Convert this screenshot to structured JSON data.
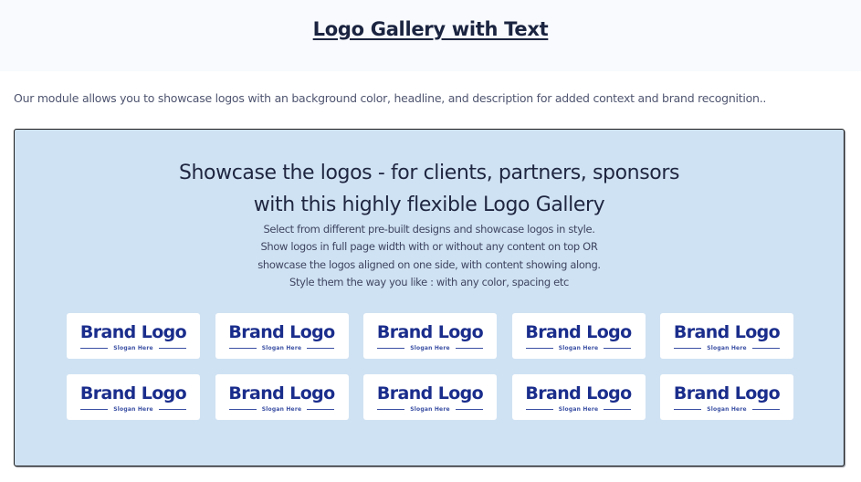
{
  "header": {
    "title": "Logo Gallery with Text"
  },
  "intro": {
    "text": "Our module allows you to showcase logos with an background color, headline, and description for added context and brand recognition.."
  },
  "showcase": {
    "headline_line1": "Showcase the logos - for clients, partners, sponsors",
    "headline_line2": "with this highly flexible Logo Gallery",
    "description_lines": [
      "Select from different pre-built designs and showcase logos in style.",
      "Show logos in full page width with or without any content on top OR",
      "showcase the logos aligned  on one side, with content showing along.",
      "Style them the way you like : with any color, spacing etc"
    ],
    "logos": [
      {
        "brand": "Brand Logo",
        "slogan": "Slogan Here"
      },
      {
        "brand": "Brand Logo",
        "slogan": "Slogan Here"
      },
      {
        "brand": "Brand Logo",
        "slogan": "Slogan Here"
      },
      {
        "brand": "Brand Logo",
        "slogan": "Slogan Here"
      },
      {
        "brand": "Brand Logo",
        "slogan": "Slogan Here"
      },
      {
        "brand": "Brand Logo",
        "slogan": "Slogan Here"
      },
      {
        "brand": "Brand Logo",
        "slogan": "Slogan Here"
      },
      {
        "brand": "Brand Logo",
        "slogan": "Slogan Here"
      },
      {
        "brand": "Brand Logo",
        "slogan": "Slogan Here"
      },
      {
        "brand": "Brand Logo",
        "slogan": "Slogan Here"
      }
    ]
  },
  "colors": {
    "box_background": "#cfe2f3",
    "brand_text": "#1a2d8c",
    "title_text": "#1b2440"
  }
}
